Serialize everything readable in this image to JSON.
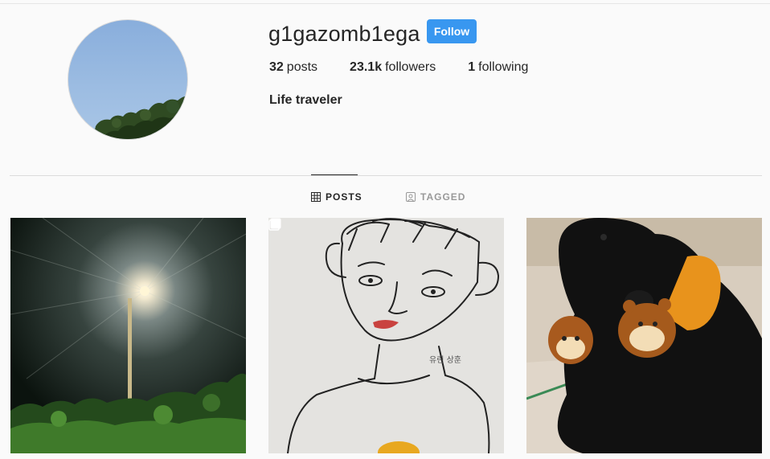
{
  "profile": {
    "username": "g1gazomb1ega",
    "follow_label": "Follow",
    "posts_count": "32",
    "posts_label": "posts",
    "followers_count": "23.1k",
    "followers_label": "followers",
    "following_count": "1",
    "following_label": "following",
    "bio": "Life traveler"
  },
  "tabs": [
    {
      "label": "POSTS",
      "icon": "grid-icon",
      "active": true
    },
    {
      "label": "TAGGED",
      "icon": "tagged-icon",
      "active": false
    }
  ],
  "posts": [
    {
      "description_icon": "photo"
    },
    {
      "description_icon": "photo",
      "multi": true
    },
    {
      "description_icon": "photo"
    }
  ],
  "colors": {
    "follow_button": "#3897f0",
    "text": "#262626",
    "muted": "#999999",
    "background": "#fafafa"
  }
}
